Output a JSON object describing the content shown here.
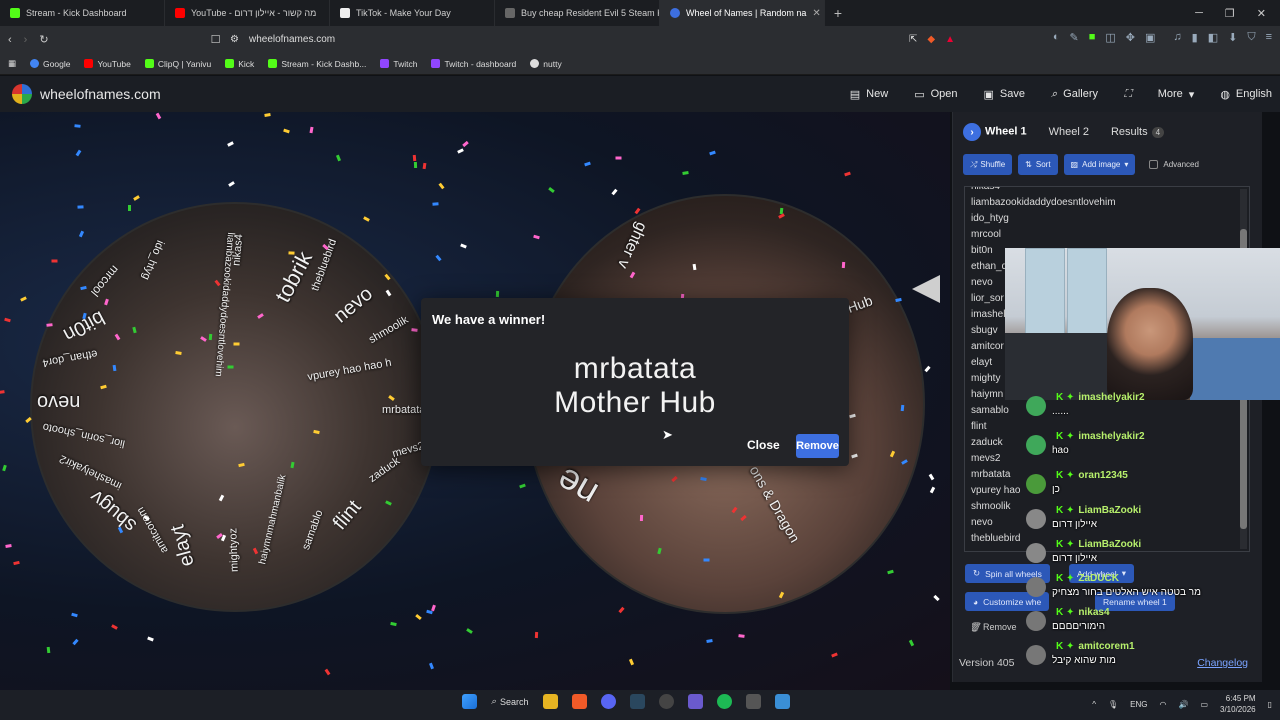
{
  "browser": {
    "tabs": [
      {
        "title": "Stream - Kick Dashboard",
        "color": "#53fc18",
        "active": false
      },
      {
        "title": "YouTube - מה קשור - איילון דרום",
        "color": "#ff0000",
        "active": false
      },
      {
        "title": "TikTok - Make Your Day",
        "color": "#ffffff",
        "active": false
      },
      {
        "title": "Buy cheap Resident Evil 5 Steam Key",
        "color": "#666666",
        "active": false
      },
      {
        "title": "Wheel of Names | Random na",
        "color": "#3d6fe0",
        "active": true
      }
    ],
    "url": "wheelofnames.com",
    "bookmarks": [
      {
        "label": "Google",
        "color": "#4285f4"
      },
      {
        "label": "YouTube",
        "color": "#ff0000"
      },
      {
        "label": "ClipQ | Yanivu",
        "color": "#53fc18"
      },
      {
        "label": "Kick",
        "color": "#53fc18"
      },
      {
        "label": "Stream - Kick Dashb...",
        "color": "#53fc18"
      },
      {
        "label": "Twitch",
        "color": "#9146ff"
      },
      {
        "label": "Twitch - dashboard",
        "color": "#9146ff"
      },
      {
        "label": "nutty",
        "color": "#dddddd"
      }
    ]
  },
  "site": {
    "brand": "wheelofnames.com",
    "menu": {
      "new": "New",
      "open": "Open",
      "save": "Save",
      "gallery": "Gallery",
      "more": "More",
      "language": "English"
    }
  },
  "wheel1_labels": [
    "tobrik",
    "nevo",
    "thebluebird",
    "nikas4",
    "liambazookidaddydoesntlovehim",
    "ido_htyg",
    "mrcool",
    "bit0n",
    "ethan_dor4",
    "nevo",
    "lior_sorin_shooto",
    "imashelyakir2",
    "sbugv",
    "amitcorem",
    "elayt",
    "mightyoz",
    "haiymnmahmanbalik",
    "samablo",
    "flint",
    "zaduck",
    "mevs2",
    "mrbatata",
    "vpurey hao hao h",
    "shmoolik"
  ],
  "wheel2_labels": [
    "ghter v",
    "Hub",
    "ons & Dragon",
    "ne"
  ],
  "modal": {
    "title": "We have a winner!",
    "winner_line1": "mrbatata",
    "winner_line2": "Mother Hub",
    "close": "Close",
    "remove": "Remove"
  },
  "panel": {
    "tabs": {
      "wheel1": "Wheel 1",
      "wheel2": "Wheel 2",
      "results": "Results",
      "results_count": "4"
    },
    "tools": {
      "shuffle": "Shuffle",
      "sort": "Sort",
      "add_image": "Add image",
      "advanced": "Advanced"
    },
    "entries": [
      "nikas4",
      "liambazookidaddydoesntlovehim",
      "ido_htyg",
      "mrcool",
      "bit0n",
      "ethan_d",
      "nevo",
      "lior_sor",
      "imashel",
      "sbugv",
      "amitcor",
      "elayt",
      "mighty",
      "haiymn",
      "samablo",
      "flint",
      "zaduck",
      "mevs2",
      "mrbatata",
      "vpurey hao",
      "shmoolik",
      "nevo",
      "thebluebird"
    ],
    "buttons": {
      "spin_all": "Spin all wheels",
      "add_wheel": "Add wheel",
      "customize": "Customize whe",
      "rename": "Rename wheel 1",
      "remove": "Remove"
    },
    "version": "Version 405",
    "changelog": "Changelog"
  },
  "chat": [
    {
      "user": "imashelyakir2",
      "text": "......",
      "color": "#3fa85a"
    },
    {
      "user": "imashelyakir2",
      "text": "hao",
      "color": "#3fa85a"
    },
    {
      "user": "oran12345",
      "text": "כן",
      "color": "#4a9a3a"
    },
    {
      "user": "LiamBaZooki",
      "text": "איילון דרום",
      "color": "#888888"
    },
    {
      "user": "LiamBaZooki",
      "text": "איילון דרום",
      "color": "#888888"
    },
    {
      "user": "ZaDUCK",
      "text": "מר בטטה איש האלטים בחור מצחיק",
      "color": "#777777"
    },
    {
      "user": "nikas4",
      "text": "הימוריםםםם",
      "color": "#777777"
    },
    {
      "user": "amitcorem1",
      "text": "מות שהוא קיבל",
      "color": "#777777"
    }
  ],
  "taskbar": {
    "search": "Search",
    "lang": "ENG",
    "time": "6:45 PM",
    "date": "3/10/2026"
  }
}
